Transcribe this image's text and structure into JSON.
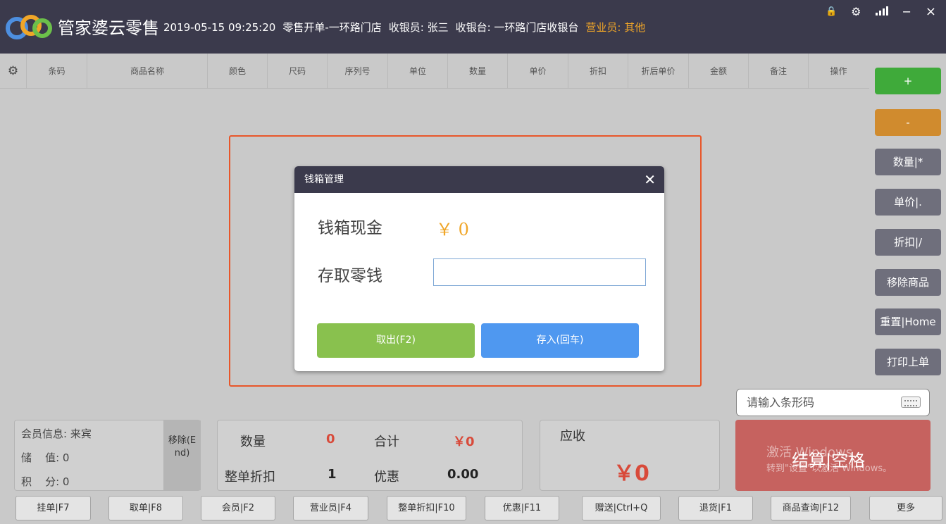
{
  "header": {
    "app_name": "管家婆云零售",
    "datetime": "2019-05-15 09:25:20",
    "mode": "零售开单",
    "store": "-一环路门店",
    "cashier": "收银员: 张三",
    "register": "收银台: 一环路门店收银台",
    "salesperson": "营业员: 其他"
  },
  "window_controls": {
    "lock": "🔒",
    "settings": "⚙",
    "signal": "",
    "minimize": "−",
    "close": "×"
  },
  "table": {
    "columns": [
      "条码",
      "商品名称",
      "颜色",
      "尺码",
      "序列号",
      "单位",
      "数量",
      "单价",
      "折扣",
      "折后单价",
      "金额",
      "备注",
      "操作"
    ]
  },
  "right_panel": {
    "buttons": [
      "+",
      "-",
      "数量|*",
      "单价|.",
      "折扣|/",
      "移除商品",
      "重置|Home",
      "打印上单"
    ]
  },
  "dialog": {
    "title": "钱箱管理",
    "cash_label": "钱箱现金",
    "cash_value": "￥ 0",
    "change_label": "存取零钱",
    "change_input_value": "",
    "withdraw_button": "取出(F2)",
    "deposit_button": "存入(回车)"
  },
  "barcode": {
    "placeholder": "请输入条形码"
  },
  "member": {
    "info": "会员信息: 来宾",
    "stored_value": "储    值: 0",
    "points": "积    分: 0",
    "remove_label": "移除(End)"
  },
  "totals": {
    "qty_label": "数量",
    "qty_value": "0",
    "sum_label": "合计",
    "sum_value": "￥0",
    "discount_label": "整单折扣",
    "discount_value": "1",
    "promo_label": "优惠",
    "promo_value": "0.00"
  },
  "receivable": {
    "label": "应收",
    "value": "￥0"
  },
  "checkout": {
    "label": "结算|空格",
    "watermark_line1": "激活 Windows",
    "watermark_line2": "转到\"设置\"以激活 Windows。"
  },
  "function_keys": [
    "挂单|F7",
    "取单|F8",
    "会员|F2",
    "营业员|F4",
    "整单折扣|F10",
    "优惠|F11",
    "赠送|Ctrl+Q",
    "退货|F1",
    "商品查询|F12",
    "更多"
  ],
  "colors": {
    "header_bg": "#3b3a4c",
    "accent_orange": "#f0a628",
    "highlight_border": "#e8562a",
    "withdraw_green": "#89c14e",
    "deposit_blue": "#4f98f0",
    "checkout_red": "#c6625f"
  }
}
